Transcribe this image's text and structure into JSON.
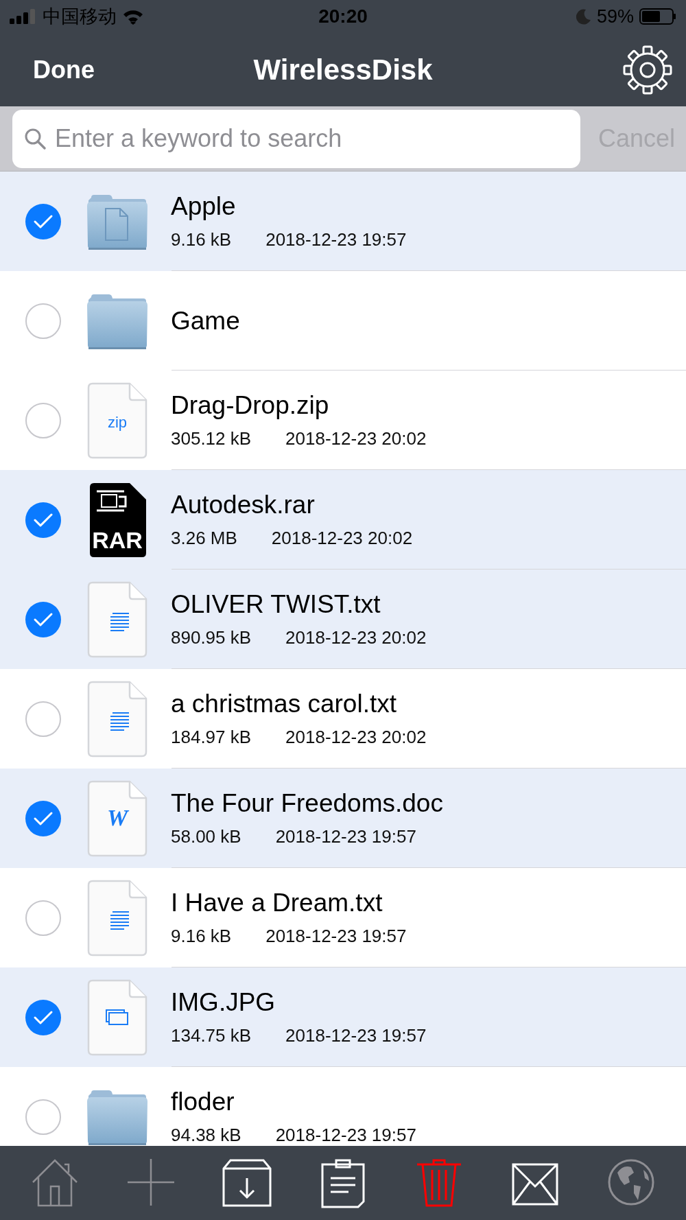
{
  "status_bar": {
    "carrier": "中国移动",
    "time": "20:20",
    "battery": "59%"
  },
  "nav_bar": {
    "left_button": "Done",
    "title": "WirelessDisk"
  },
  "search": {
    "placeholder": "Enter a keyword to search",
    "cancel": "Cancel"
  },
  "files": [
    {
      "name": "Apple",
      "size": "9.16 kB",
      "date": "2018-12-23 19:57",
      "kind": "folder_doc",
      "selected": true
    },
    {
      "name": "Game",
      "kind": "folder",
      "selected": false
    },
    {
      "name": "Drag-Drop.zip",
      "size": "305.12 kB",
      "date": "2018-12-23 20:02",
      "kind": "zip",
      "icon_label": "zip",
      "selected": false
    },
    {
      "name": "Autodesk.rar",
      "size": "3.26 MB",
      "date": "2018-12-23 20:02",
      "kind": "rar",
      "icon_label": "RAR",
      "selected": true
    },
    {
      "name": "OLIVER TWIST.txt",
      "size": "890.95 kB",
      "date": "2018-12-23 20:02",
      "kind": "txt",
      "selected": true
    },
    {
      "name": "a christmas carol.txt",
      "size": "184.97 kB",
      "date": "2018-12-23 20:02",
      "kind": "txt",
      "selected": false
    },
    {
      "name": "The Four Freedoms.doc",
      "size": "58.00 kB",
      "date": "2018-12-23 19:57",
      "kind": "doc",
      "icon_label": "W",
      "selected": true
    },
    {
      "name": "I Have a Dream.txt",
      "size": "9.16 kB",
      "date": "2018-12-23 19:57",
      "kind": "txt",
      "selected": false
    },
    {
      "name": "IMG.JPG",
      "size": "134.75 kB",
      "date": "2018-12-23 19:57",
      "kind": "image",
      "selected": true
    },
    {
      "name": "floder",
      "size": "94.38 kB",
      "date": "2018-12-23 19:57",
      "kind": "folder",
      "selected": false
    }
  ],
  "toolbar": [
    {
      "kind": "home",
      "disabled": true
    },
    {
      "kind": "add",
      "disabled": true
    },
    {
      "kind": "download",
      "disabled": false
    },
    {
      "kind": "clipboard",
      "disabled": false
    },
    {
      "kind": "trash",
      "disabled": false
    },
    {
      "kind": "mail",
      "disabled": false
    },
    {
      "kind": "globe",
      "disabled": true
    }
  ]
}
